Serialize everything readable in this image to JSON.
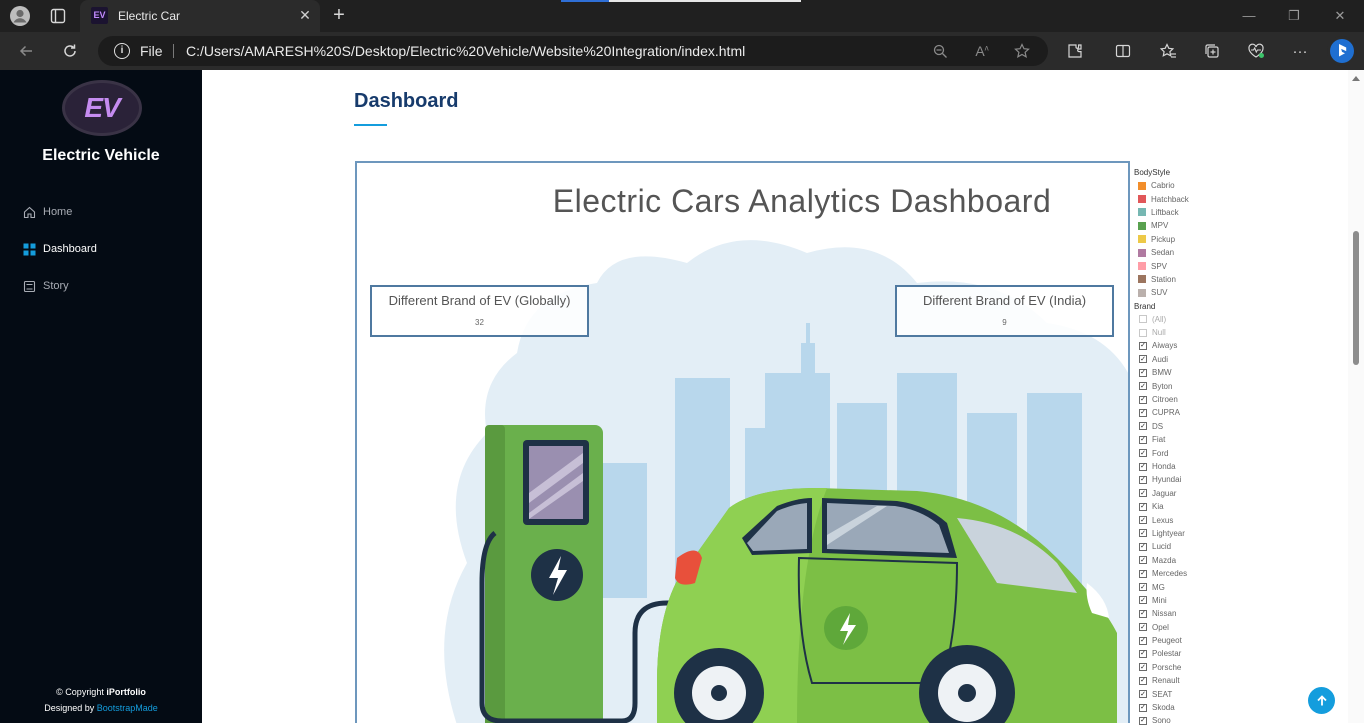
{
  "browser": {
    "tab_title": "Electric Car",
    "tab_favicon_text": "EV",
    "address_scheme": "File",
    "address_url": "C:/Users/AMARESH%20S/Desktop/Electric%20Vehicle/Website%20Integration/index.html",
    "load_progress": 0.2
  },
  "sidebar": {
    "logo_text": "EV",
    "brand": "Electric Vehicle",
    "menu": [
      {
        "label": "Home",
        "icon": "house-icon",
        "active": false
      },
      {
        "label": "Dashboard",
        "icon": "grid-icon",
        "active": true
      },
      {
        "label": "Story",
        "icon": "book-icon",
        "active": false
      }
    ],
    "footer": {
      "copyright_prefix": "© Copyright ",
      "copyright_name": "iPortfolio",
      "designed_prefix": "Designed by ",
      "designed_link": "BootstrapMade"
    }
  },
  "main": {
    "section_title": "Dashboard"
  },
  "dashboard": {
    "title": "Electric Cars Analytics Dashboard",
    "kpis": [
      {
        "label": "Different Brand of EV (Globally)",
        "value": "32"
      },
      {
        "label": "Different Brand of EV (India)",
        "value": "9"
      }
    ],
    "bodystyle_legend": {
      "title": "BodyStyle",
      "items": [
        {
          "label": "Cabrio",
          "color": "#f28e2b"
        },
        {
          "label": "Hatchback",
          "color": "#e15759"
        },
        {
          "label": "Liftback",
          "color": "#76b7b2"
        },
        {
          "label": "MPV",
          "color": "#59a14f"
        },
        {
          "label": "Pickup",
          "color": "#edc948"
        },
        {
          "label": "Sedan",
          "color": "#b07aa1"
        },
        {
          "label": "SPV",
          "color": "#ff9da7"
        },
        {
          "label": "Station",
          "color": "#9c755f"
        },
        {
          "label": "SUV",
          "color": "#bab0ac"
        }
      ]
    },
    "brand_filter": {
      "title": "Brand",
      "items": [
        {
          "label": "(All)",
          "checked": false
        },
        {
          "label": "Null",
          "checked": false
        },
        {
          "label": "Aiways",
          "checked": true
        },
        {
          "label": "Audi",
          "checked": true
        },
        {
          "label": "BMW",
          "checked": true
        },
        {
          "label": "Byton",
          "checked": true
        },
        {
          "label": "Citroen",
          "checked": true
        },
        {
          "label": "CUPRA",
          "checked": true
        },
        {
          "label": "DS",
          "checked": true
        },
        {
          "label": "Fiat",
          "checked": true
        },
        {
          "label": "Ford",
          "checked": true
        },
        {
          "label": "Honda",
          "checked": true
        },
        {
          "label": "Hyundai",
          "checked": true
        },
        {
          "label": "Jaguar",
          "checked": true
        },
        {
          "label": "Kia",
          "checked": true
        },
        {
          "label": "Lexus",
          "checked": true
        },
        {
          "label": "Lightyear",
          "checked": true
        },
        {
          "label": "Lucid",
          "checked": true
        },
        {
          "label": "Mazda",
          "checked": true
        },
        {
          "label": "Mercedes",
          "checked": true
        },
        {
          "label": "MG",
          "checked": true
        },
        {
          "label": "Mini",
          "checked": true
        },
        {
          "label": "Nissan",
          "checked": true
        },
        {
          "label": "Opel",
          "checked": true
        },
        {
          "label": "Peugeot",
          "checked": true
        },
        {
          "label": "Polestar",
          "checked": true
        },
        {
          "label": "Porsche",
          "checked": true
        },
        {
          "label": "Renault",
          "checked": true
        },
        {
          "label": "SEAT",
          "checked": true
        },
        {
          "label": "Skoda",
          "checked": true
        },
        {
          "label": "Sono",
          "checked": true
        }
      ]
    }
  }
}
